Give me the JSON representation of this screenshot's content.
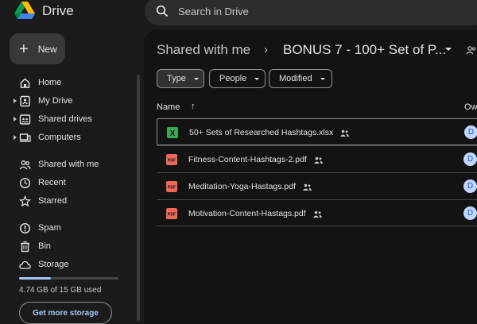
{
  "app": {
    "name": "Drive"
  },
  "search": {
    "placeholder": "Search in Drive"
  },
  "new_button": {
    "label": "New"
  },
  "nav": {
    "items": [
      {
        "label": "Home",
        "icon": "home-icon",
        "expandable": false
      },
      {
        "label": "My Drive",
        "icon": "my-drive-icon",
        "expandable": true
      },
      {
        "label": "Shared drives",
        "icon": "shared-drives-icon",
        "expandable": true
      },
      {
        "label": "Computers",
        "icon": "computers-icon",
        "expandable": true
      }
    ],
    "items2": [
      {
        "label": "Shared with me",
        "icon": "shared-with-me-icon"
      },
      {
        "label": "Recent",
        "icon": "recent-icon"
      },
      {
        "label": "Starred",
        "icon": "star-icon"
      }
    ],
    "items3": [
      {
        "label": "Spam",
        "icon": "spam-icon"
      },
      {
        "label": "Bin",
        "icon": "bin-icon"
      },
      {
        "label": "Storage",
        "icon": "cloud-icon"
      }
    ]
  },
  "storage": {
    "used_text": "4.74 GB of 15 GB used",
    "used_fraction": 0.316,
    "button": "Get more storage"
  },
  "breadcrumb": {
    "parent": "Shared with me",
    "separator": "›",
    "current": "BONUS 7 - 100+ Set of P..."
  },
  "filters": {
    "type": "Type",
    "people": "People",
    "modified": "Modified"
  },
  "columns": {
    "name": "Name",
    "sort": "↑",
    "owner": "Ow"
  },
  "files": [
    {
      "name": "50+ Sets of Researched Hashtags.xlsx",
      "type": "xlsx",
      "owner": "D"
    },
    {
      "name": "Fitness-Content-Hashtags-2.pdf",
      "type": "pdf",
      "owner": "D"
    },
    {
      "name": "Meditation-Yoga-Hastags.pdf",
      "type": "pdf",
      "owner": "D"
    },
    {
      "name": "Motivation-Content-Hastags.pdf",
      "type": "pdf",
      "owner": "D"
    }
  ],
  "colors": {
    "accent": "#a8c7fa",
    "excel": "#34a853",
    "pdf": "#ee675c",
    "avatar": "#c2d7ff"
  }
}
